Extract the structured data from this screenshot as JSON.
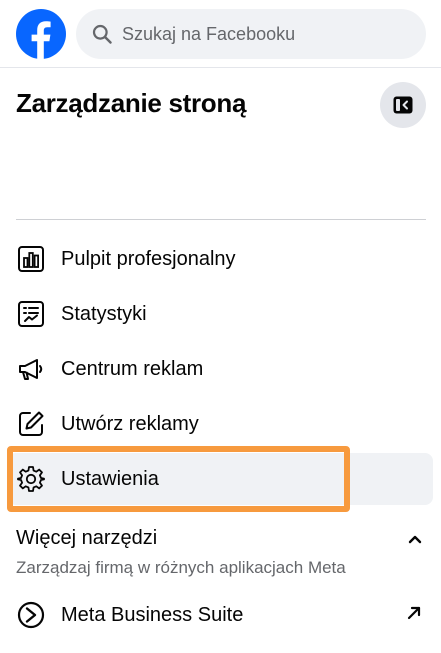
{
  "header": {
    "logo_icon": "facebook-logo",
    "brand_color": "#0866ff",
    "search": {
      "placeholder": "Szukaj na Facebooku",
      "value": ""
    }
  },
  "panel": {
    "title": "Zarządzanie stroną",
    "collapse_icon": "sidebar-collapse-icon"
  },
  "menu": {
    "items": [
      {
        "label": "Pulpit profesjonalny",
        "icon": "dashboard-chart-icon"
      },
      {
        "label": "Statystyki",
        "icon": "insights-icon"
      },
      {
        "label": "Centrum reklam",
        "icon": "megaphone-icon"
      },
      {
        "label": "Utwórz reklamy",
        "icon": "edit-icon"
      },
      {
        "label": "Ustawienia",
        "icon": "gear-icon",
        "selected": true
      }
    ]
  },
  "more_tools": {
    "title": "Więcej narzędzi",
    "subtitle": "Zarządzaj firmą w różnych aplikacjach Meta",
    "items": [
      {
        "label": "Meta Business Suite",
        "icon": "meta-business-suite-icon",
        "external_icon": "external-arrow-icon"
      }
    ]
  },
  "highlight_color": "#f79a3e"
}
